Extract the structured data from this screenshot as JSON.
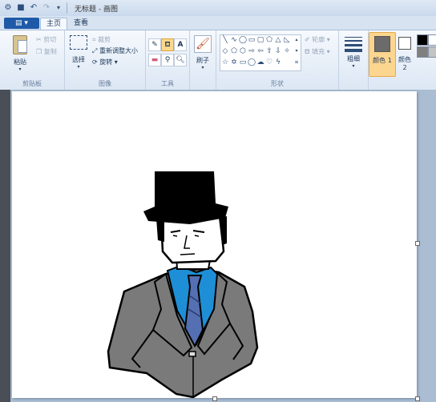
{
  "window": {
    "title": "无标题 - 画图"
  },
  "quick_access": {
    "icons": [
      "app-menu-icon",
      "save-icon",
      "undo-icon",
      "redo-icon",
      "customize-icon"
    ]
  },
  "tabs": {
    "file": "",
    "home": "主页",
    "view": "查看"
  },
  "clipboard": {
    "paste": "粘贴",
    "cut": "剪切",
    "copy": "复制",
    "label": "剪贴板"
  },
  "image": {
    "select": "选择",
    "crop": "裁剪",
    "resize": "重新调整大小",
    "rotate": "旋转",
    "label": "图像"
  },
  "tools": {
    "label": "工具"
  },
  "brushes": {
    "label": "刷子"
  },
  "shapes": {
    "outline": "轮廓",
    "fill": "填充",
    "label": "形状"
  },
  "size": {
    "label": "粗细"
  },
  "colors": {
    "color1": "颜色 1",
    "color2": "颜色 2",
    "color1_value": "#6b6b6b",
    "color2_value": "#ffffff",
    "palette": [
      "#000000",
      "#ffffff",
      "#7f7f7f",
      "#c3c3c3"
    ]
  },
  "canvas": {
    "background": "#ffffff"
  },
  "drawing": {
    "hat": "#000000",
    "jacket": "#7a7a7a",
    "shirt": "#1e8fd6",
    "tie": "#5470b2"
  }
}
